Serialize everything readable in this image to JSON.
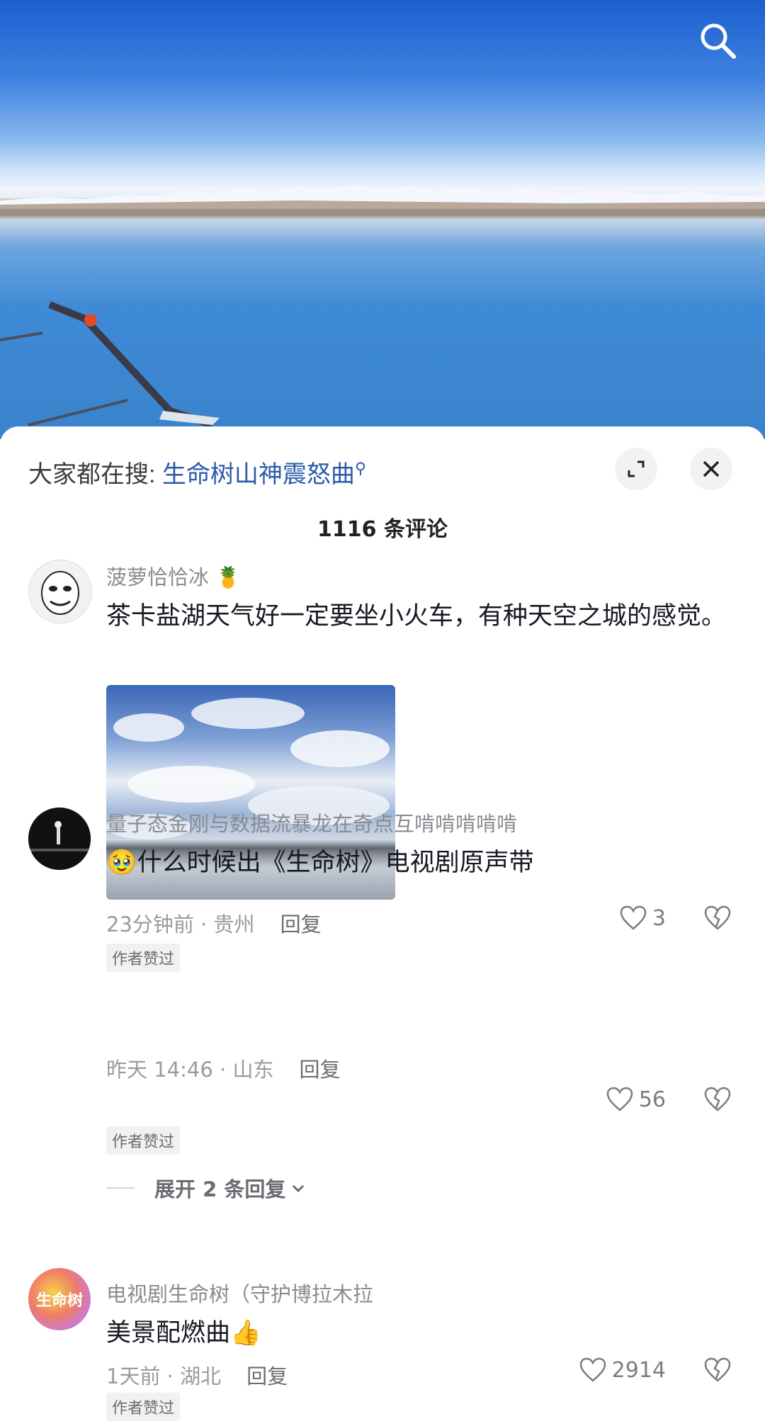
{
  "trending": {
    "prefix": "大家都在搜: ",
    "query": "生命树山神震怒曲"
  },
  "comment_count": "1116 条评论",
  "comments": [
    {
      "username": "菠萝恰恰冰",
      "text": "茶卡盐湖天气好一定要坐小火车，有种天空之城的感觉。",
      "time_location": "23分钟前 · 贵州",
      "reply_label": "回复",
      "badge": "作者赞过",
      "likes": "3"
    },
    {
      "username": "量子态金刚与数据流暴龙在奇点互啃啃啃啃啃",
      "text": "什么时候出《生命树》电视剧原声带",
      "time_location": "昨天 14:46 · 山东",
      "reply_label": "回复",
      "badge": "作者赞过",
      "likes": "56",
      "expand_label": "展开 2 条回复"
    },
    {
      "username": "电视剧生命树（守护博拉木拉",
      "text": "美景配燃曲",
      "time_location": "1天前 · 湖北",
      "reply_label": "回复",
      "badge": "作者赞过",
      "likes": "2914",
      "avatar_text": "生命树"
    }
  ]
}
